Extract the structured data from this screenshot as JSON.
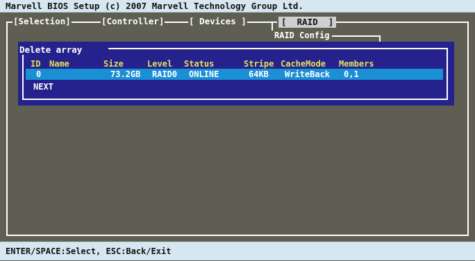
{
  "title": "Marvell BIOS Setup (c) 2007 Marvell Technology Group Ltd.",
  "tabs": [
    {
      "label": "[Selection]"
    },
    {
      "label": "[Controller]"
    },
    {
      "label": "[ Devices ]"
    },
    {
      "label": "[  RAID  ]",
      "active": true
    }
  ],
  "raid_config_label": "RAID Config",
  "dialog": {
    "title": "Delete array",
    "columns": [
      "ID",
      "Name",
      "Size",
      "Level",
      "Status",
      "Stripe",
      "CacheMode",
      "Members"
    ],
    "rows": [
      {
        "id": "0",
        "name": "",
        "size": "73.2GB",
        "level": "RAID0",
        "status": "ONLINE",
        "stripe": "64KB",
        "cache_mode": "WriteBack",
        "members": "0,1",
        "selected": true
      }
    ],
    "next_label": "NEXT"
  },
  "status_bar": "ENTER/SPACE:Select, ESC:Back/Exit",
  "colors": {
    "background": "#5e5e52",
    "bars": "#d6e7f1",
    "dialog": "#25228d",
    "highlight": "#1b8fd4",
    "header_text": "#e2e05a"
  }
}
